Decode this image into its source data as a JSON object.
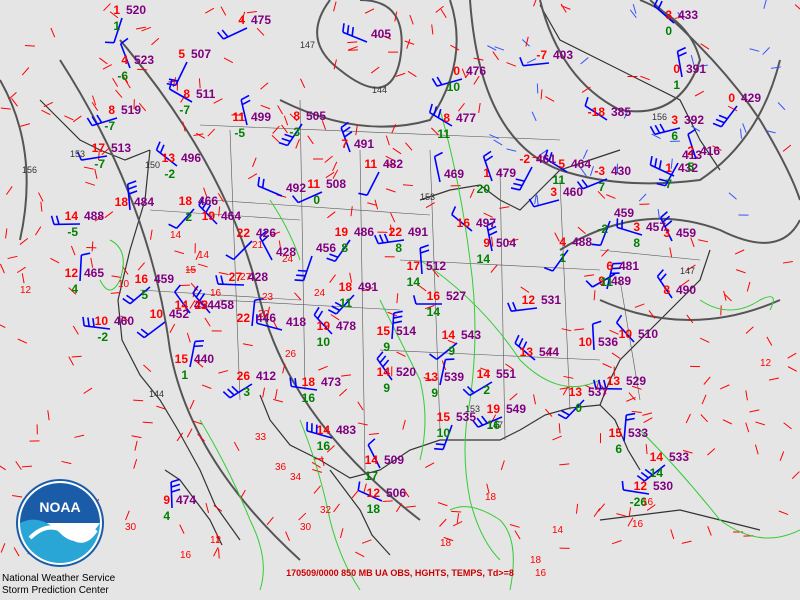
{
  "caption": "170509/0000 850 MB UA OBS, HGHTS, TEMPS, Td>=8",
  "credit": {
    "line1": "National Weather Service",
    "line2": "Storm Prediction Center"
  },
  "logo_text": "NOAA",
  "colors": {
    "background": "#e5e5e5",
    "temperature": "#ff0000",
    "height": "#800080",
    "dewpoint": "#008000",
    "isotherm_dashed": "#ff0000",
    "moisture_contour": "#33cc33",
    "height_contour": "#555555",
    "wind_barb": "#0000ff",
    "noaa_blue": "#1a5ca8"
  },
  "contour_labels": [
    "156",
    "153",
    "150",
    "147",
    "144",
    "153",
    "147",
    "153",
    "156",
    "144",
    "147"
  ],
  "stations": [
    {
      "t": "1",
      "h": "520",
      "d": "1"
    },
    {
      "t": "4",
      "h": "475",
      "d": ""
    },
    {
      "t": "",
      "h": "405",
      "d": ""
    },
    {
      "t": "4",
      "h": "523",
      "d": "-6"
    },
    {
      "t": "5",
      "h": "507",
      "d": ""
    },
    {
      "t": "8",
      "h": "519",
      "d": "-7"
    },
    {
      "t": "8",
      "h": "511",
      "d": "-7"
    },
    {
      "t": "11",
      "h": "499",
      "d": "-5"
    },
    {
      "t": "8",
      "h": "505",
      "d": "-3"
    },
    {
      "t": "17",
      "h": "513",
      "d": "-7"
    },
    {
      "t": "13",
      "h": "496",
      "d": "-2"
    },
    {
      "t": "18",
      "h": "484",
      "d": ""
    },
    {
      "t": "18",
      "h": "466",
      "d": "2"
    },
    {
      "t": "14",
      "h": "488",
      "d": "-5"
    },
    {
      "t": "19",
      "h": "464",
      "d": ""
    },
    {
      "t": "12",
      "h": "465",
      "d": "4"
    },
    {
      "t": "16",
      "h": "459",
      "d": "5"
    },
    {
      "t": "10",
      "h": "460",
      "d": "-2"
    },
    {
      "t": "14",
      "h": "454",
      "d": ""
    },
    {
      "t": "15",
      "h": "440",
      "d": "1"
    },
    {
      "t": "26",
      "h": "412",
      "d": "3"
    },
    {
      "t": "",
      "h": "418",
      "d": ""
    },
    {
      "t": "",
      "h": "428",
      "d": ""
    },
    {
      "t": "",
      "h": "456",
      "d": ""
    },
    {
      "t": "11",
      "h": "508",
      "d": "0"
    },
    {
      "t": "",
      "h": "492",
      "d": ""
    },
    {
      "t": "7",
      "h": "491",
      "d": ""
    },
    {
      "t": "11",
      "h": "482",
      "d": ""
    },
    {
      "t": "0",
      "h": "476",
      "d": "10"
    },
    {
      "t": "8",
      "h": "477",
      "d": "11"
    },
    {
      "t": "",
      "h": "469",
      "d": ""
    },
    {
      "t": "19",
      "h": "486",
      "d": "8"
    },
    {
      "t": "22",
      "h": "491",
      "d": "8"
    },
    {
      "t": "16",
      "h": "497",
      "d": ""
    },
    {
      "t": "17",
      "h": "512",
      "d": "14"
    },
    {
      "t": "18",
      "h": "491",
      "d": "11"
    },
    {
      "t": "16",
      "h": "527",
      "d": "14"
    },
    {
      "t": "19",
      "h": "478",
      "d": "10"
    },
    {
      "t": "15",
      "h": "514",
      "d": "9"
    },
    {
      "t": "14",
      "h": "543",
      "d": "9"
    },
    {
      "t": "18",
      "h": "473",
      "d": "16"
    },
    {
      "t": "14",
      "h": "520",
      "d": "9"
    },
    {
      "t": "13",
      "h": "539",
      "d": "9"
    },
    {
      "t": "14",
      "h": "551",
      "d": "2"
    },
    {
      "t": "14",
      "h": "483",
      "d": "16"
    },
    {
      "t": "14",
      "h": "509",
      "d": "17"
    },
    {
      "t": "15",
      "h": "535",
      "d": "10"
    },
    {
      "t": "19",
      "h": "549",
      "d": "16"
    },
    {
      "t": "12",
      "h": "506",
      "d": "18"
    },
    {
      "t": "1",
      "h": "479",
      "d": "20"
    },
    {
      "t": "-2",
      "h": "461",
      "d": ""
    },
    {
      "t": "3",
      "h": "460",
      "d": ""
    },
    {
      "t": "5",
      "h": "464",
      "d": "11"
    },
    {
      "t": "9",
      "h": "504",
      "d": "14"
    },
    {
      "t": "4",
      "h": "488",
      "d": "1"
    },
    {
      "t": "12",
      "h": "531",
      "d": ""
    },
    {
      "t": "13",
      "h": "544",
      "d": ""
    },
    {
      "t": "10",
      "h": "536",
      "d": ""
    },
    {
      "t": "13",
      "h": "537",
      "d": "0"
    },
    {
      "t": "13",
      "h": "529",
      "d": ""
    },
    {
      "t": "10",
      "h": "510",
      "d": ""
    },
    {
      "t": "15",
      "h": "533",
      "d": "6"
    },
    {
      "t": "14",
      "h": "533",
      "d": "14"
    },
    {
      "t": "12",
      "h": "530",
      "d": "-26"
    },
    {
      "t": "8",
      "h": "490",
      "d": ""
    },
    {
      "t": "9",
      "h": "489",
      "d": ""
    },
    {
      "t": "6",
      "h": "481",
      "d": "11"
    },
    {
      "t": "3",
      "h": "457",
      "d": "8"
    },
    {
      "t": "3",
      "h": "459",
      "d": ""
    },
    {
      "t": "",
      "h": "459",
      "d": "-2"
    },
    {
      "t": "-3",
      "h": "430",
      "d": "7"
    },
    {
      "t": "1",
      "h": "432",
      "d": "7"
    },
    {
      "t": "2",
      "h": "416",
      "d": "5"
    },
    {
      "t": "",
      "h": "413",
      "d": ""
    },
    {
      "t": "3",
      "h": "392",
      "d": "6"
    },
    {
      "t": "-18",
      "h": "385",
      "d": ""
    },
    {
      "t": "0",
      "h": "391",
      "d": "1"
    },
    {
      "t": "0",
      "h": "429",
      "d": ""
    },
    {
      "t": "-7",
      "h": "403",
      "d": ""
    },
    {
      "t": "3",
      "h": "433",
      "d": "0"
    },
    {
      "t": "9",
      "h": "474",
      "d": "4"
    },
    {
      "t": "22",
      "h": "426",
      "d": ""
    },
    {
      "t": "27",
      "h": "428",
      "d": ""
    },
    {
      "t": "22",
      "h": "458",
      "d": ""
    },
    {
      "t": "22",
      "h": "446",
      "d": ""
    },
    {
      "t": "10",
      "h": "452",
      "d": ""
    }
  ],
  "loose_temps": [
    "-14",
    "-14",
    "-15",
    "-16",
    "-18",
    "-18",
    "-30",
    "-32",
    "-33",
    "-34",
    "-36",
    "-30",
    "-16",
    "-16",
    "-14",
    "-12",
    "-12",
    "-10",
    "-12",
    "-24",
    "-27",
    "-21",
    "-23",
    "-24",
    "-20",
    "-26",
    "-16",
    "-16",
    "-18"
  ]
}
